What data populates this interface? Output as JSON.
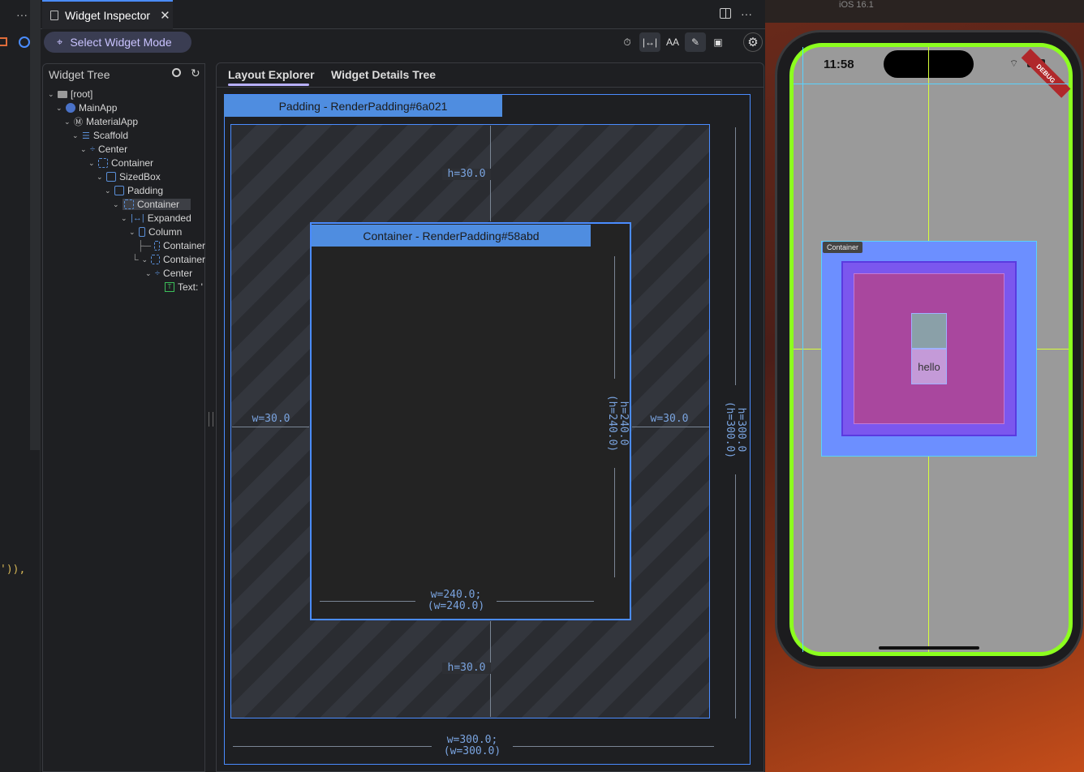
{
  "editor": {
    "snippet": "')),"
  },
  "tab": {
    "title": "Widget Inspector",
    "more": "···"
  },
  "toolbar": {
    "select_mode": "Select Widget Mode",
    "text_scale_label": "AA"
  },
  "tree": {
    "title": "Widget Tree",
    "nodes": [
      {
        "label": "[root]"
      },
      {
        "label": "MainApp"
      },
      {
        "label": "MaterialApp"
      },
      {
        "label": "Scaffold"
      },
      {
        "label": "Center"
      },
      {
        "label": "Container"
      },
      {
        "label": "SizedBox"
      },
      {
        "label": "Padding"
      },
      {
        "label": "Container"
      },
      {
        "label": "Expanded"
      },
      {
        "label": "Column"
      },
      {
        "label": "Container"
      },
      {
        "label": "Container"
      },
      {
        "label": "Center"
      },
      {
        "label": "Text: '"
      }
    ]
  },
  "subtabs": {
    "layout_explorer": "Layout Explorer",
    "details_tree": "Widget Details Tree"
  },
  "layout": {
    "parent_label": "Padding - RenderPadding#6a021",
    "child_label": "Container - RenderPadding#58abd",
    "top_pad": "h=30.0",
    "bottom_pad": "h=30.0",
    "left_pad": "w=30.0",
    "right_pad": "w=30.0",
    "child_w": "w=240.0;",
    "child_w2": "(w=240.0)",
    "child_h": "h=240.0",
    "child_h2": "(h=240.0)",
    "parent_w": "w=300.0;",
    "parent_w2": "(w=300.0)",
    "parent_h": "h=300.0",
    "parent_h2": "(h=300.0)"
  },
  "device": {
    "os_label": "iOS 16.1",
    "time": "11:58",
    "debug_banner": "DEBUG",
    "tooltip": "Container",
    "text": "hello"
  }
}
